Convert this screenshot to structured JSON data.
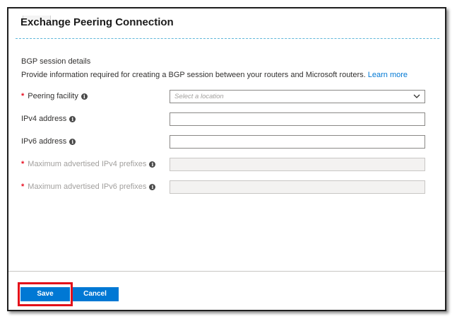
{
  "panel": {
    "title": "Exchange Peering Connection"
  },
  "section": {
    "title": "BGP session details",
    "description": "Provide information required for creating a BGP session between your routers and Microsoft routers.",
    "learn_more": "Learn more"
  },
  "fields": [
    {
      "label": "Peering facility",
      "required": true,
      "disabled": false,
      "type": "select",
      "placeholder": "Select a location",
      "value": ""
    },
    {
      "label": "IPv4 address",
      "required": false,
      "disabled": false,
      "type": "text",
      "value": ""
    },
    {
      "label": "IPv6 address",
      "required": false,
      "disabled": false,
      "type": "text",
      "value": ""
    },
    {
      "label": "Maximum advertised IPv4 prefixes",
      "required": true,
      "disabled": true,
      "type": "text",
      "value": ""
    },
    {
      "label": "Maximum advertised IPv6 prefixes",
      "required": true,
      "disabled": true,
      "type": "text",
      "value": ""
    }
  ],
  "footer": {
    "save_label": "Save",
    "cancel_label": "Cancel"
  },
  "colors": {
    "accent": "#0078d4",
    "required_star": "#e81123",
    "highlight": "#e3101a"
  },
  "icons": {
    "info": "info-icon",
    "dropdown": "chevron-down-icon"
  },
  "required_marker": "*",
  "info_glyph": "i"
}
